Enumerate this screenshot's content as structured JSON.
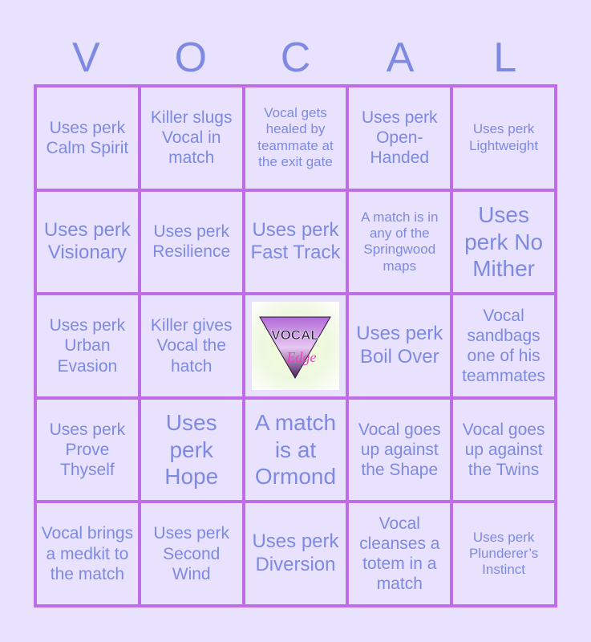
{
  "header": [
    "V",
    "O",
    "C",
    "A",
    "L"
  ],
  "cells": [
    {
      "text": "Uses perk Calm Spirit",
      "size": "s-md"
    },
    {
      "text": "Killer slugs Vocal in match",
      "size": "s-md"
    },
    {
      "text": "Vocal gets healed by teammate at the exit gate",
      "size": "s-sm"
    },
    {
      "text": "Uses perk Open-Handed",
      "size": "s-md"
    },
    {
      "text": "Uses perk Lightweight",
      "size": "s-sm"
    },
    {
      "text": "Uses perk Visionary",
      "size": "s-lg"
    },
    {
      "text": "Uses perk Resilience",
      "size": "s-md"
    },
    {
      "text": "Uses perk Fast Track",
      "size": "s-lg"
    },
    {
      "text": "A match is in any of the Springwood maps",
      "size": "s-sm"
    },
    {
      "text": "Uses perk No Mither",
      "size": "s-xl"
    },
    {
      "text": "Uses perk Urban Evasion",
      "size": "s-md"
    },
    {
      "text": "Killer gives Vocal the hatch",
      "size": "s-md"
    },
    {
      "text": "FREE",
      "size": "free",
      "free": true,
      "logo_text": "VOCAL",
      "logo_sub": "Edge"
    },
    {
      "text": "Uses perk Boil Over",
      "size": "s-lg"
    },
    {
      "text": "Vocal sandbags one of his teammates",
      "size": "s-md"
    },
    {
      "text": "Uses perk Prove Thyself",
      "size": "s-md"
    },
    {
      "text": "Uses perk Hope",
      "size": "s-xl"
    },
    {
      "text": "A match is at Ormond",
      "size": "s-xl"
    },
    {
      "text": "Vocal goes up against the Shape",
      "size": "s-md"
    },
    {
      "text": "Vocal goes up against the Twins",
      "size": "s-md"
    },
    {
      "text": "Vocal brings a medkit to the match",
      "size": "s-md"
    },
    {
      "text": "Uses perk Second Wind",
      "size": "s-md"
    },
    {
      "text": "Uses perk Diversion",
      "size": "s-lg"
    },
    {
      "text": "Vocal cleanses a totem in a match",
      "size": "s-md"
    },
    {
      "text": "Uses perk Plunderer’s Instinct",
      "size": "s-sm"
    }
  ]
}
